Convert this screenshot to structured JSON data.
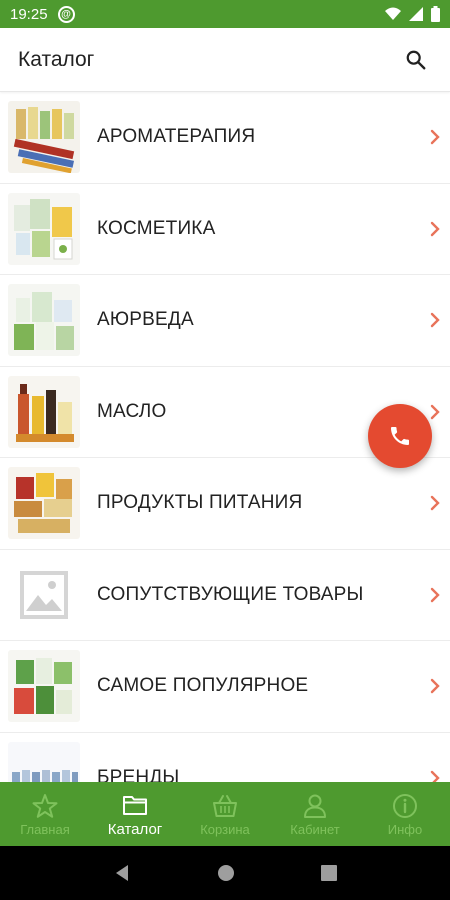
{
  "status": {
    "time": "19:25"
  },
  "header": {
    "title": "Каталог"
  },
  "categories": [
    {
      "label": "АРОМАТЕРАПИЯ",
      "thumb": "product-photo"
    },
    {
      "label": "КОСМЕТИКА",
      "thumb": "product-photo"
    },
    {
      "label": "АЮРВЕДА",
      "thumb": "product-photo"
    },
    {
      "label": "МАСЛО",
      "thumb": "product-photo"
    },
    {
      "label": "ПРОДУКТЫ ПИТАНИЯ",
      "thumb": "product-photo"
    },
    {
      "label": "СОПУТСТВУЮЩИЕ ТОВАРЫ",
      "thumb": "image-placeholder-icon"
    },
    {
      "label": "САМОЕ ПОПУЛЯРНОЕ",
      "thumb": "product-photo"
    },
    {
      "label": "БРЕНДЫ",
      "thumb": "product-photo"
    }
  ],
  "bottom_nav": [
    {
      "label": "Главная",
      "icon": "star-icon",
      "active": false
    },
    {
      "label": "Каталог",
      "icon": "folder-icon",
      "active": true
    },
    {
      "label": "Корзина",
      "icon": "basket-icon",
      "active": false
    },
    {
      "label": "Кабинет",
      "icon": "user-icon",
      "active": false
    },
    {
      "label": "Инфо",
      "icon": "info-icon",
      "active": false
    }
  ],
  "colors": {
    "primary": "#4e9a2f",
    "accent": "#e44a30",
    "chevron": "#e8735a",
    "inactive_nav": "#7fc25c"
  }
}
